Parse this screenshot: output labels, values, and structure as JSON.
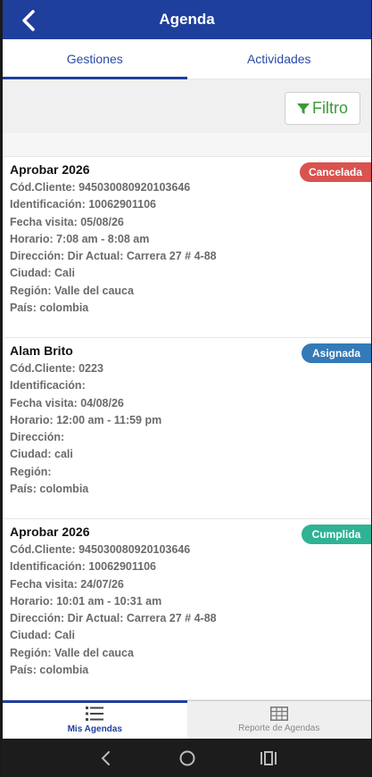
{
  "header": {
    "title": "Agenda"
  },
  "tabs": [
    {
      "label": "Gestiones",
      "active": true
    },
    {
      "label": "Actividades",
      "active": false
    }
  ],
  "filter": {
    "label": "Filtro",
    "icon": "filter-icon",
    "color": "#3a9a3a"
  },
  "agendas": [
    {
      "title": "Aprobar 2026",
      "status": "Cancelada",
      "status_color": "#d9534f",
      "fields": [
        {
          "label": "Cód.Cliente:",
          "value": "945030080920103646"
        },
        {
          "label": "Identificación:",
          "value": "10062901106"
        },
        {
          "label": "Fecha visita:",
          "value": "05/08/26"
        },
        {
          "label": "Horario:",
          "value": "7:08 am - 8:08 am"
        },
        {
          "label": "Dirección:",
          "value": "Dir Actual: Carrera 27 # 4-88"
        },
        {
          "label": "Ciudad:",
          "value": "Cali"
        },
        {
          "label": "Región:",
          "value": "Valle del cauca"
        },
        {
          "label": "País:",
          "value": "colombia"
        }
      ]
    },
    {
      "title": "Alam Brito",
      "status": "Asignada",
      "status_color": "#337ab7",
      "fields": [
        {
          "label": "Cód.Cliente:",
          "value": "0223"
        },
        {
          "label": "Identificación:",
          "value": ""
        },
        {
          "label": "Fecha visita:",
          "value": "04/08/26"
        },
        {
          "label": "Horario:",
          "value": "12:00 am - 11:59 pm"
        },
        {
          "label": "Dirección:",
          "value": ""
        },
        {
          "label": "Ciudad:",
          "value": "cali"
        },
        {
          "label": "Región:",
          "value": ""
        },
        {
          "label": "País:",
          "value": "colombia"
        }
      ]
    },
    {
      "title": "Aprobar 2026",
      "status": "Cumplida",
      "status_color": "#2fb394",
      "fields": [
        {
          "label": "Cód.Cliente:",
          "value": "945030080920103646"
        },
        {
          "label": "Identificación:",
          "value": "10062901106"
        },
        {
          "label": "Fecha visita:",
          "value": "24/07/26"
        },
        {
          "label": "Horario:",
          "value": "10:01 am - 10:31 am"
        },
        {
          "label": "Dirección:",
          "value": "Dir Actual: Carrera 27 # 4-88"
        },
        {
          "label": "Ciudad:",
          "value": "Cali"
        },
        {
          "label": "Región:",
          "value": "Valle del cauca"
        },
        {
          "label": "País:",
          "value": "colombia"
        }
      ]
    }
  ],
  "bottom_nav": [
    {
      "label": "Mis Agendas",
      "icon": "list-icon",
      "active": true
    },
    {
      "label": "Reporte de Agendas",
      "icon": "table-icon",
      "active": false
    }
  ],
  "system_nav": [
    {
      "icon": "back-chevron-icon"
    },
    {
      "icon": "home-circle-icon"
    },
    {
      "icon": "recents-icon"
    }
  ],
  "colors": {
    "primary": "#1f3f9d",
    "accent_tab": "#2a4aa8"
  }
}
